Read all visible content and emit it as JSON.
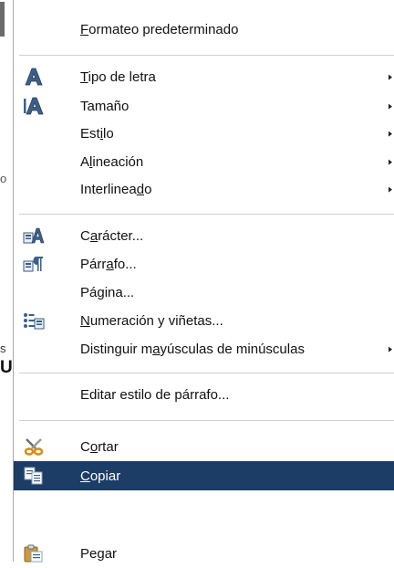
{
  "background": {
    "partial_text_1": "o",
    "partial_text_2": "s",
    "partial_text_3": "U"
  },
  "menu": {
    "selected_color": "#1b3d66",
    "items": [
      {
        "label": "Formateo predeterminado",
        "mnemonic_index": 0,
        "icon": "",
        "submenu": false
      },
      {
        "label": "Tipo de letra",
        "mnemonic_index": 0,
        "icon": "font-a-icon",
        "submenu": true
      },
      {
        "label": "Tamaño",
        "mnemonic_index": -1,
        "icon": "font-size-icon",
        "submenu": true
      },
      {
        "label": "Estilo",
        "mnemonic_index": 3,
        "icon": "",
        "submenu": true
      },
      {
        "label": "Alineación",
        "mnemonic_index": 1,
        "icon": "",
        "submenu": true
      },
      {
        "label": "Interlineado",
        "mnemonic_index": 10,
        "icon": "",
        "submenu": true
      },
      {
        "label": "Carácter...",
        "mnemonic_index": 1,
        "icon": "character-dialog-icon",
        "submenu": false
      },
      {
        "label": "Párrafo...",
        "mnemonic_index": 4,
        "icon": "paragraph-dialog-icon",
        "submenu": false
      },
      {
        "label": "Página...",
        "mnemonic_index": 2,
        "icon": "",
        "submenu": false
      },
      {
        "label": "Numeración y viñetas...",
        "mnemonic_index": 0,
        "icon": "bullets-numbering-icon",
        "submenu": false
      },
      {
        "label": "Distinguir mayúsculas de minúsculas",
        "mnemonic_index": 12,
        "icon": "",
        "submenu": true
      },
      {
        "label": "Editar estilo de párrafo...",
        "mnemonic_index": -1,
        "icon": "",
        "submenu": false
      },
      {
        "label": "Cortar",
        "mnemonic_index": 1,
        "icon": "scissors-icon",
        "submenu": false
      },
      {
        "label": "Copiar",
        "mnemonic_index": 0,
        "icon": "copy-icon",
        "submenu": false,
        "selected": true
      },
      {
        "label": "Pegar",
        "mnemonic_index": -1,
        "icon": "paste-icon",
        "submenu": false
      }
    ]
  }
}
